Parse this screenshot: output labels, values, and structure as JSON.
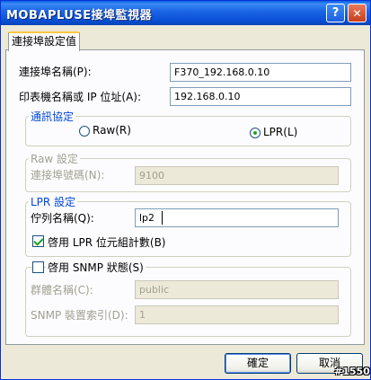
{
  "window": {
    "title": "MOBAPLUSE接埠監視器"
  },
  "tab": {
    "label": "連接埠設定值"
  },
  "fields": {
    "port_name": {
      "label": "連接埠名稱(P):",
      "value": "F370_192.168.0.10"
    },
    "printer_ip": {
      "label": "印表機名稱或 IP 位址(A):",
      "value": "192.168.0.10"
    }
  },
  "protocol": {
    "legend": "通訊協定",
    "raw_label": "Raw(R)",
    "lpr_label": "LPR(L)",
    "selected": "LPR"
  },
  "raw_settings": {
    "legend": "Raw 設定",
    "port_number_label": "連接埠號碼(N):",
    "port_number_value": "9100"
  },
  "lpr_settings": {
    "legend": "LPR 設定",
    "queue_name_label": "佇列名稱(Q):",
    "queue_name_value": "lp2",
    "byte_count_label": "啓用 LPR 位元組計數(B)",
    "byte_count_checked": true
  },
  "snmp": {
    "enable_label": "啓用 SNMP 狀態(S)",
    "enable_checked": false,
    "community_label": "群體名稱(C):",
    "community_value": "public",
    "device_index_label": "SNMP 裝置索引(D):",
    "device_index_value": "1"
  },
  "buttons": {
    "ok": "確定",
    "cancel": "取消"
  },
  "watermark": "#1550",
  "colors": {
    "titlebar": "#0a5fe3",
    "group_blue": "#0046d5",
    "check_green": "#21a121"
  }
}
